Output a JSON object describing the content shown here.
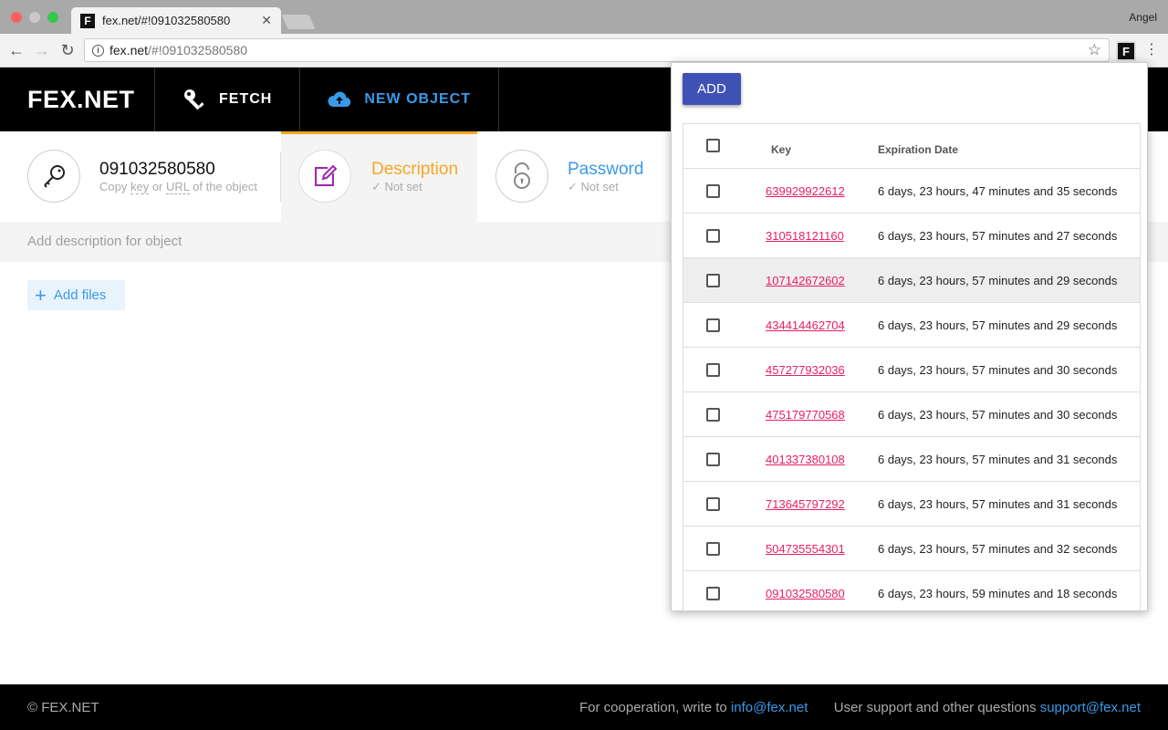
{
  "browser": {
    "tab_title": "fex.net/#!091032580580",
    "tab_favicon": "F",
    "profile_name": "Angel",
    "url_host": "fex.net",
    "url_rest": "/#!091032580580",
    "extension_letter": "F"
  },
  "app": {
    "logo": "FEX.NET",
    "nav": [
      {
        "label": "FETCH",
        "icon": "key-icon"
      },
      {
        "label": "NEW OBJECT",
        "icon": "cloud-upload-icon"
      }
    ]
  },
  "object": {
    "key": "091032580580",
    "key_hint_prefix": "Copy ",
    "key_hint_key": "key",
    "key_hint_mid": " or ",
    "key_hint_url": "URL",
    "key_hint_suffix": " of the object",
    "description_title": "Description",
    "description_status": "Not set",
    "password_title": "Password",
    "password_status": "Not set",
    "description_placeholder": "Add description for object",
    "add_files_label": "Add files"
  },
  "colors": {
    "accent_blue": "#3a9ae8",
    "description_orange": "#f5a623",
    "add_button": "#3f51b5",
    "link_pink": "#e91e63"
  },
  "footer": {
    "copyright": "© FEX.NET",
    "coop_text": "For cooperation, write to ",
    "coop_email": "info@fex.net",
    "support_text": "User support and other questions ",
    "support_email": "support@fex.net"
  },
  "popup": {
    "add_label": "ADD",
    "col_key": "Key",
    "col_expiration": "Expiration Date",
    "rows": [
      {
        "key": "639929922612",
        "expires": "6 days, 23 hours, 47 minutes and 35 seconds"
      },
      {
        "key": "310518121160",
        "expires": "6 days, 23 hours, 57 minutes and 27 seconds"
      },
      {
        "key": "107142672602",
        "expires": "6 days, 23 hours, 57 minutes and 29 seconds"
      },
      {
        "key": "434414462704",
        "expires": "6 days, 23 hours, 57 minutes and 29 seconds"
      },
      {
        "key": "457277932036",
        "expires": "6 days, 23 hours, 57 minutes and 30 seconds"
      },
      {
        "key": "475179770568",
        "expires": "6 days, 23 hours, 57 minutes and 30 seconds"
      },
      {
        "key": "401337380108",
        "expires": "6 days, 23 hours, 57 minutes and 31 seconds"
      },
      {
        "key": "713645797292",
        "expires": "6 days, 23 hours, 57 minutes and 31 seconds"
      },
      {
        "key": "504735554301",
        "expires": "6 days, 23 hours, 57 minutes and 32 seconds"
      },
      {
        "key": "091032580580",
        "expires": "6 days, 23 hours, 59 minutes and 18 seconds"
      }
    ]
  }
}
